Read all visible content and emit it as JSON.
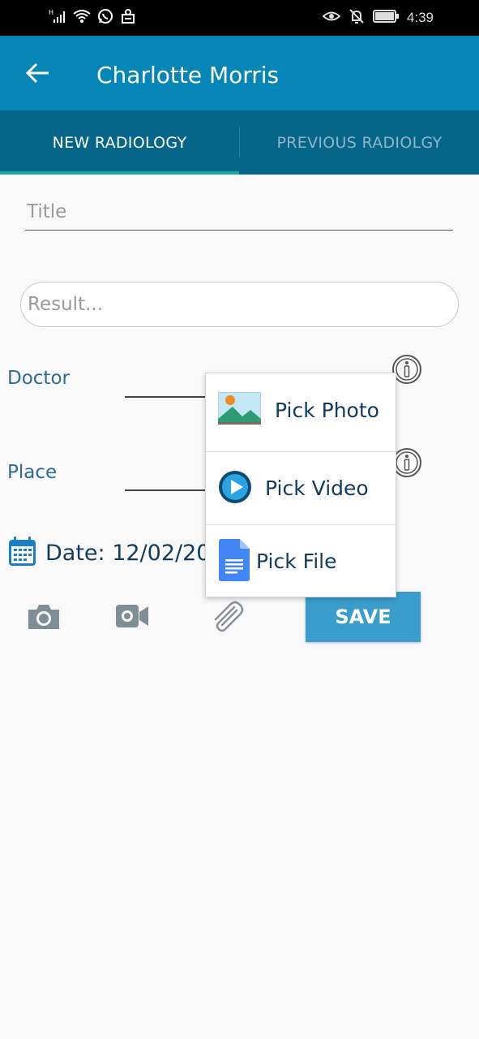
{
  "status_bar": {
    "time": "4:39",
    "icons": [
      "signal-icon",
      "wifi-icon",
      "whatsapp-icon",
      "notification-icon",
      "eye-icon",
      "bell-off-icon",
      "battery-icon"
    ]
  },
  "app_bar": {
    "title": "Charlotte Morris",
    "back_icon": "arrow-left-icon"
  },
  "tabs": [
    {
      "label": "NEW RADIOLOGY",
      "active": true
    },
    {
      "label": "PREVIOUS RADIOLGY",
      "active": false
    }
  ],
  "form": {
    "title_placeholder": "Title",
    "result_placeholder": "Result...",
    "doctor_label": "Doctor",
    "place_label": "Place",
    "date_text": "Date: 12/02/20"
  },
  "toolbar": {
    "camera_icon": "camera-icon",
    "video_icon": "video-camera-icon",
    "attach_icon": "paperclip-icon",
    "save_label": "SAVE"
  },
  "popup_menu": {
    "items": [
      {
        "label": "Pick Photo",
        "icon": "image-icon"
      },
      {
        "label": "Pick Video",
        "icon": "play-icon"
      },
      {
        "label": "Pick File",
        "icon": "document-icon"
      }
    ]
  },
  "colors": {
    "app_bar": "#0586b6",
    "tab_bar": "#05668a",
    "tab_indicator": "#18a8a0",
    "save_button": "#3a9dcc",
    "label_text": "#2e6b96"
  }
}
